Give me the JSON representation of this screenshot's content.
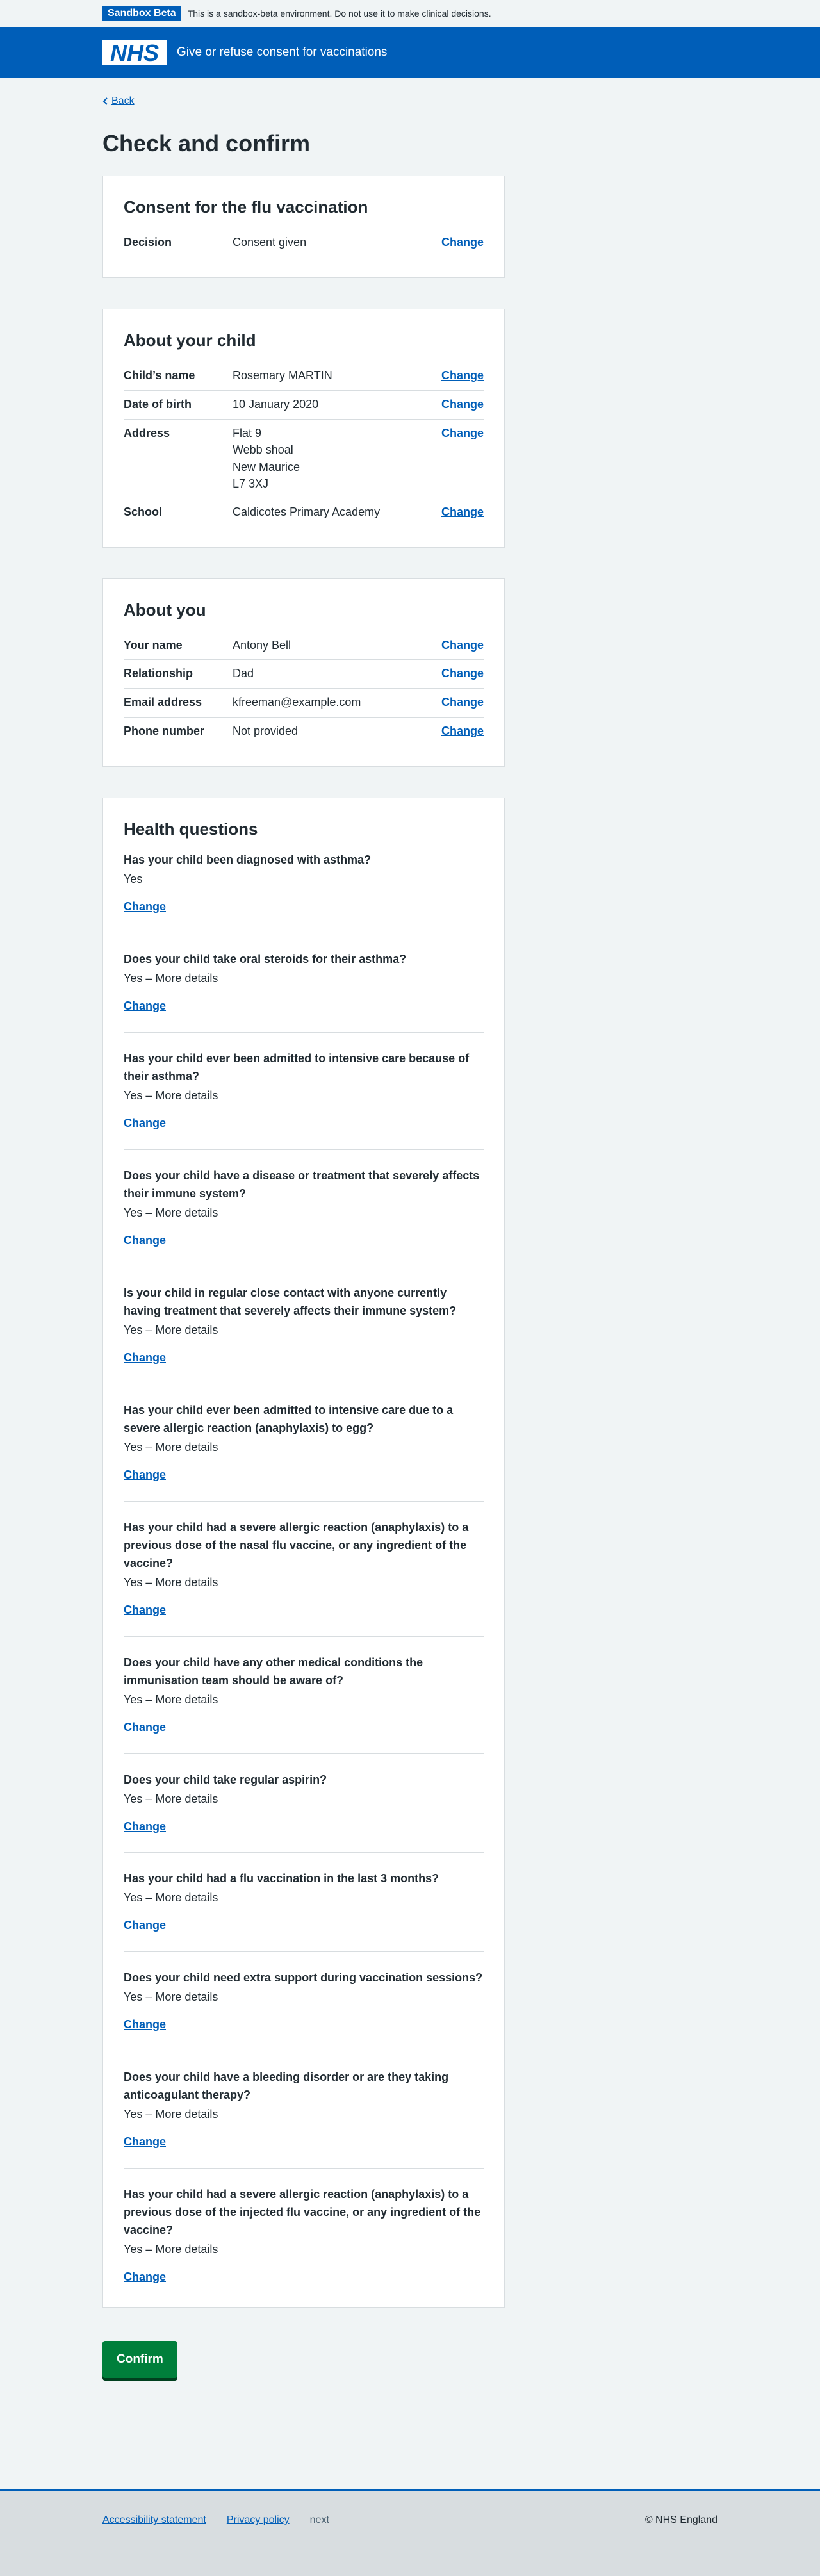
{
  "sandbox": {
    "tag": "Sandbox Beta",
    "text": "This is a sandbox-beta environment. Do not use it to make clinical decisions."
  },
  "header": {
    "logo_text": "NHS",
    "service_name": "Give or refuse consent for vaccinations"
  },
  "back_link": "Back",
  "page_title": "Check and confirm",
  "consent": {
    "title": "Consent for the flu vaccination",
    "rows": [
      {
        "key": "Decision",
        "value": "Consent given",
        "action": "Change"
      }
    ]
  },
  "child": {
    "title": "About your child",
    "rows": [
      {
        "key": "Child’s name",
        "value": "Rosemary MARTIN",
        "action": "Change"
      },
      {
        "key": "Date of birth",
        "value": "10 January 2020",
        "action": "Change"
      },
      {
        "key": "Address",
        "lines": [
          "Flat 9",
          "Webb shoal",
          "New Maurice",
          "L7 3XJ"
        ],
        "action": "Change"
      },
      {
        "key": "School",
        "value": "Caldicotes Primary Academy",
        "action": "Change"
      }
    ]
  },
  "you": {
    "title": "About you",
    "rows": [
      {
        "key": "Your name",
        "value": "Antony Bell",
        "action": "Change"
      },
      {
        "key": "Relationship",
        "value": "Dad",
        "action": "Change"
      },
      {
        "key": "Email address",
        "value": "kfreeman@example.com",
        "action": "Change"
      },
      {
        "key": "Phone number",
        "value": "Not provided",
        "action": "Change"
      }
    ]
  },
  "health": {
    "title": "Health questions",
    "items": [
      {
        "q": "Has your child been diagnosed with asthma?",
        "a": "Yes",
        "action": "Change"
      },
      {
        "q": "Does your child take oral steroids for their asthma?",
        "a": "Yes – More details",
        "action": "Change"
      },
      {
        "q": "Has your child ever been admitted to intensive care because of their asthma?",
        "a": "Yes – More details",
        "action": "Change"
      },
      {
        "q": "Does your child have a disease or treatment that severely affects their immune system?",
        "a": "Yes – More details",
        "action": "Change"
      },
      {
        "q": "Is your child in regular close contact with anyone currently having treatment that severely affects their immune system?",
        "a": "Yes – More details",
        "action": "Change"
      },
      {
        "q": "Has your child ever been admitted to intensive care due to a severe allergic reaction (anaphylaxis) to egg?",
        "a": "Yes – More details",
        "action": "Change"
      },
      {
        "q": "Has your child had a severe allergic reaction (anaphylaxis) to a previous dose of the nasal flu vaccine, or any ingredient of the vaccine?",
        "a": "Yes – More details",
        "action": "Change"
      },
      {
        "q": "Does your child have any other medical conditions the immunisation team should be aware of?",
        "a": "Yes – More details",
        "action": "Change"
      },
      {
        "q": "Does your child take regular aspirin?",
        "a": "Yes – More details",
        "action": "Change"
      },
      {
        "q": "Has your child had a flu vaccination in the last 3 months?",
        "a": "Yes – More details",
        "action": "Change"
      },
      {
        "q": "Does your child need extra support during vaccination sessions?",
        "a": "Yes – More details",
        "action": "Change"
      },
      {
        "q": "Does your child have a bleeding disorder or are they taking anticoagulant therapy?",
        "a": "Yes – More details",
        "action": "Change"
      },
      {
        "q": "Has your child had a severe allergic reaction (anaphylaxis) to a previous dose of the injected flu vaccine, or any ingredient of the vaccine?",
        "a": "Yes – More details",
        "action": "Change"
      }
    ]
  },
  "confirm_button": "Confirm",
  "footer": {
    "links": [
      "Accessibility statement",
      "Privacy policy"
    ],
    "next": "next",
    "copyright": "© NHS England"
  },
  "colors": {
    "nhs_blue": "#005eb8",
    "button_green": "#007f3b",
    "background": "#f0f4f5"
  }
}
